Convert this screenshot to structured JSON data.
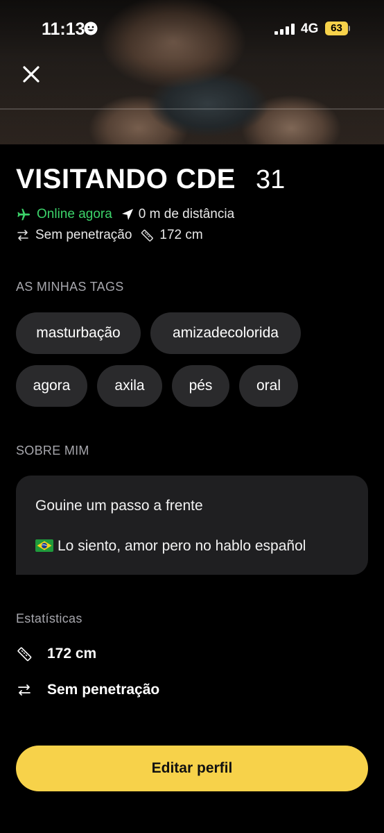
{
  "status_bar": {
    "time": "11:13",
    "network": "4G",
    "battery": "63",
    "accent_color": "#f7d24a"
  },
  "header": {
    "close_icon": "close-icon"
  },
  "profile": {
    "name": "VISITANDO CDE",
    "age": "31",
    "online_status": "Online agora",
    "online_color": "#3cd36a",
    "distance": "0 m de distância",
    "position": "Sem penetração",
    "height": "172 cm"
  },
  "tags_section": {
    "title": "AS MINHAS TAGS",
    "tags": [
      "masturbação",
      "amizadecolorida",
      "agora",
      "axila",
      "pés",
      "oral"
    ]
  },
  "about_section": {
    "title": "SOBRE MIM",
    "line1": "Gouine um passo a frente",
    "line2": "Lo siento, amor pero no hablo español",
    "flag_icon": "brazil-flag-icon"
  },
  "stats_section": {
    "title": "Estatísticas",
    "height": "172 cm",
    "position": "Sem penetração"
  },
  "actions": {
    "edit_profile": "Editar perfil"
  }
}
